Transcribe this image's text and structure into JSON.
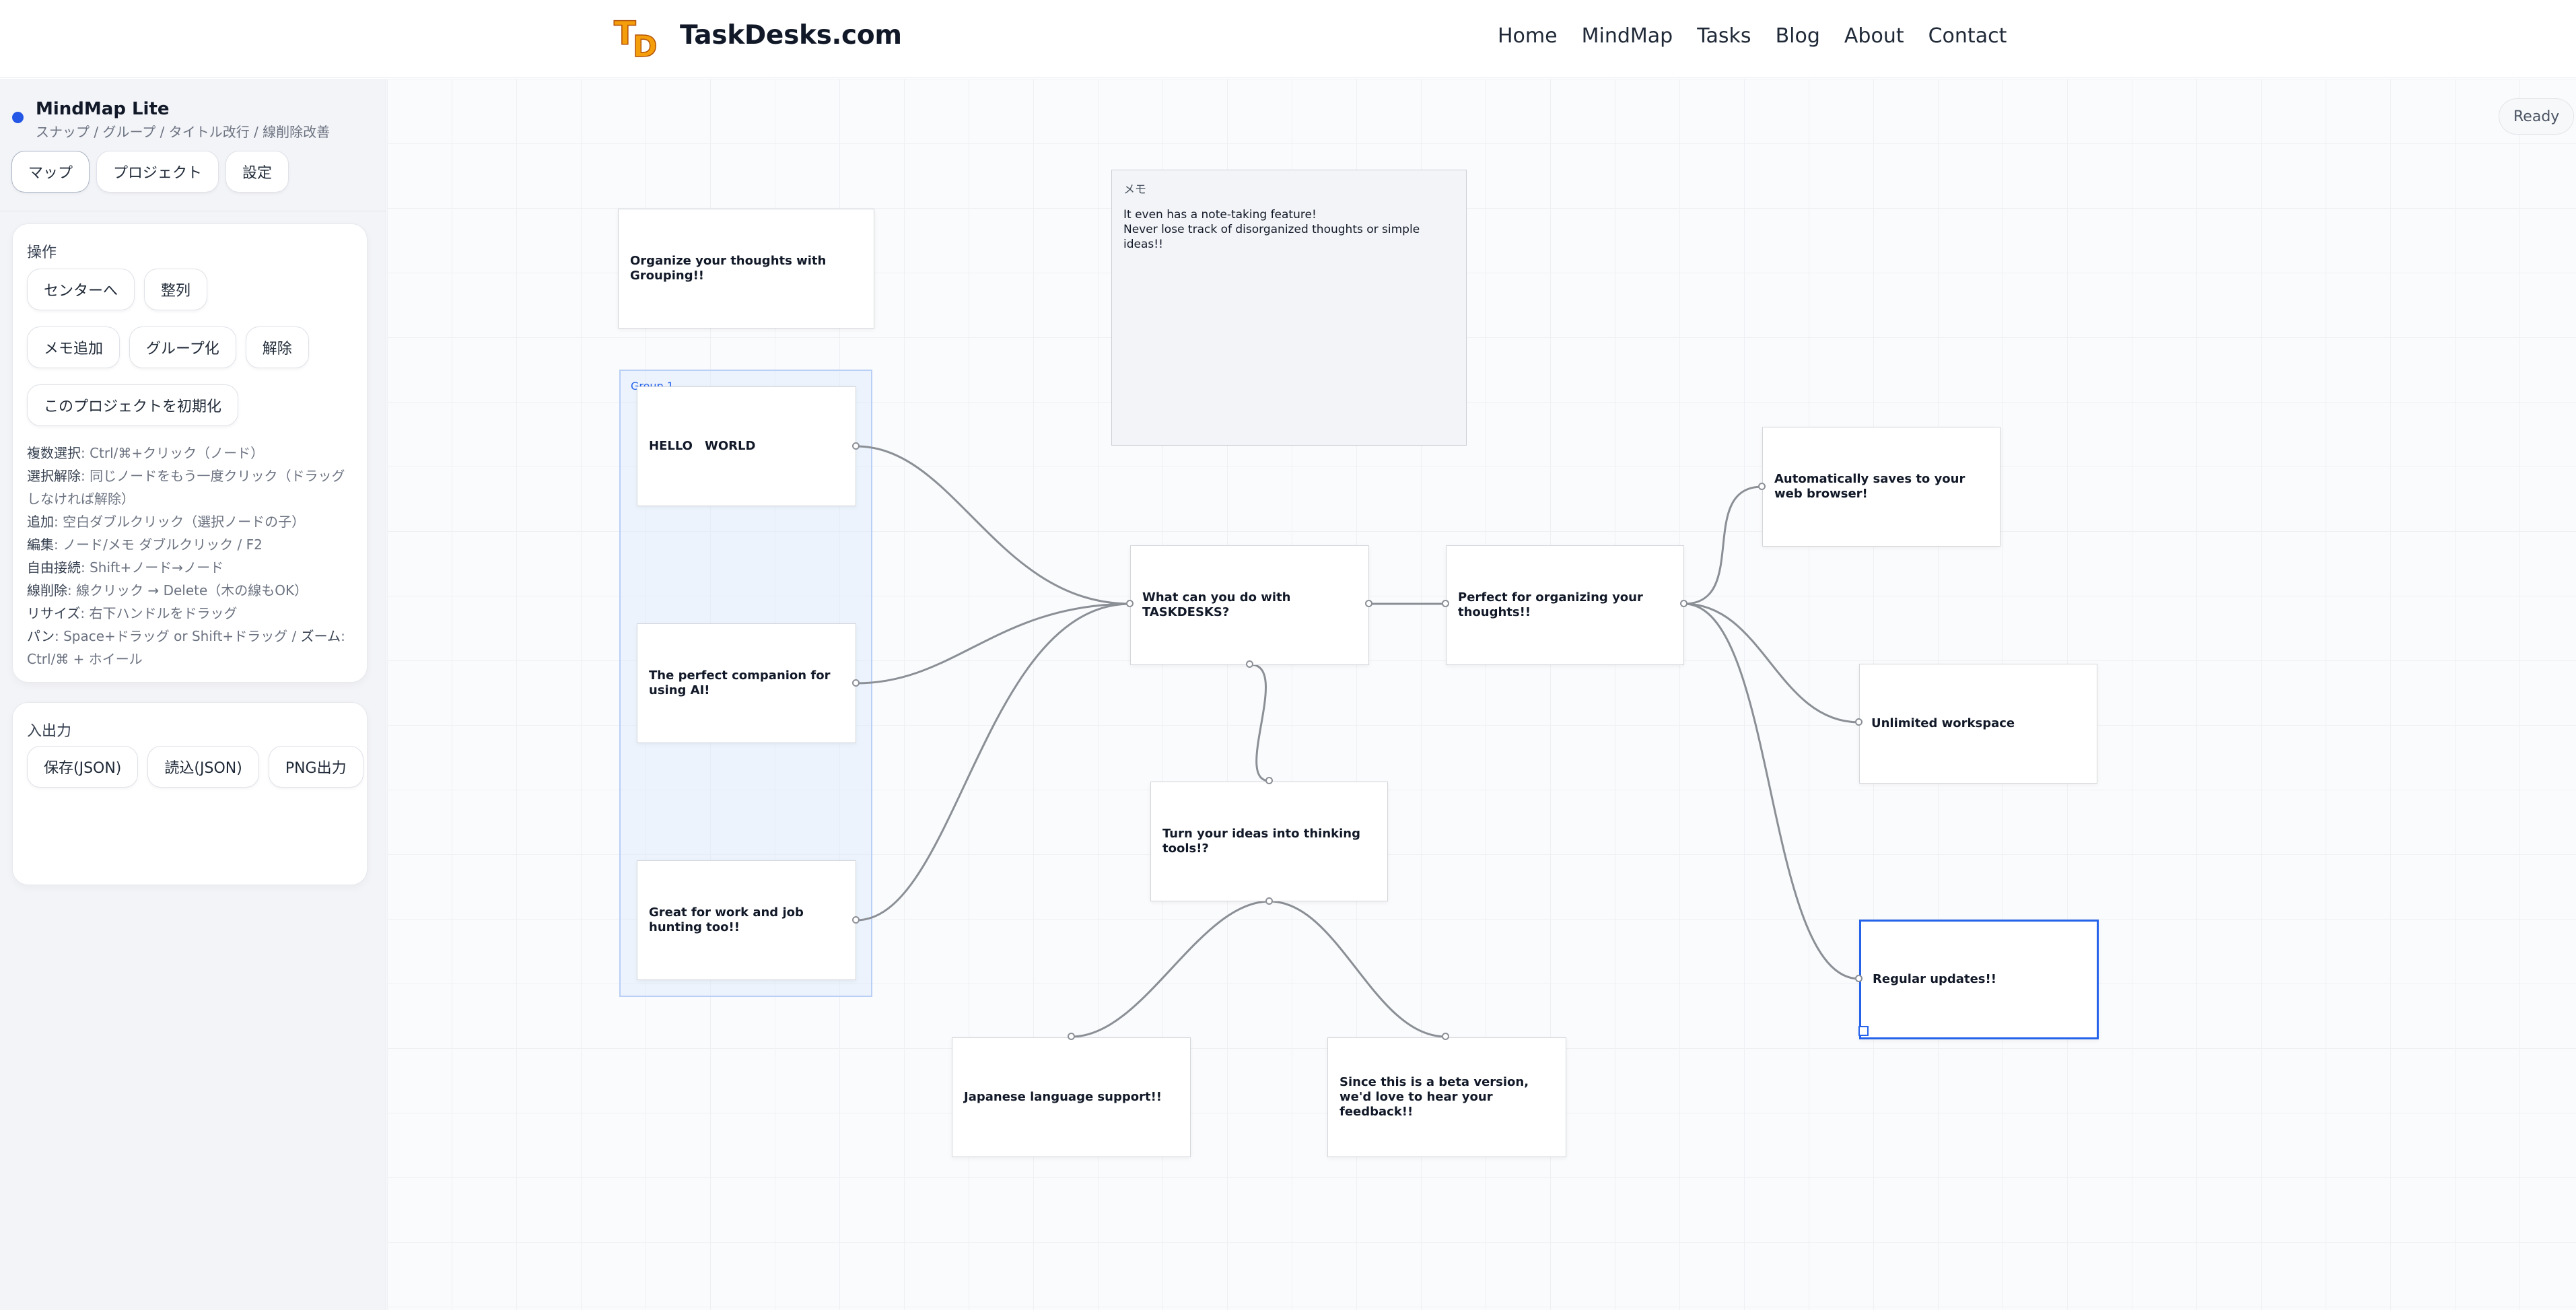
{
  "header": {
    "brand": "TaskDesks.com",
    "logo_text": "TD",
    "nav": [
      "Home",
      "MindMap",
      "Tasks",
      "Blog",
      "About",
      "Contact"
    ]
  },
  "sidebar": {
    "app_title": "MindMap Lite",
    "app_subtitle": "スナップ / グループ / タイトル改行 / 線削除改善",
    "tabs": [
      "マップ",
      "プロジェクト",
      "設定"
    ],
    "operations": {
      "title": "操作",
      "buttons": [
        "センターへ",
        "整列",
        "メモ追加",
        "グループ化",
        "解除",
        "このプロジェクトを初期化"
      ]
    },
    "help": [
      {
        "key": "複数選択",
        "text": ": Ctrl/⌘+クリック（ノード）"
      },
      {
        "key": "選択解除",
        "text": ": 同じノードをもう一度クリック（ドラッグしなければ解除）"
      },
      {
        "key": "追加",
        "text": ": 空白ダブルクリック（選択ノードの子）"
      },
      {
        "key": "編集",
        "text": ": ノード/メモ ダブルクリック / F2"
      },
      {
        "key": "自由接続",
        "text": ": Shift+ノード→ノード"
      },
      {
        "key": "線削除",
        "text": ": 線クリック → Delete（木の線もOK）"
      },
      {
        "key": "リサイズ",
        "text": ": 右下ハンドルをドラッグ"
      },
      {
        "key": "パン",
        "text": ": Space+ドラッグ or Shift+ドラッグ / "
      },
      {
        "key": "ズーム",
        "text": ": Ctrl/⌘ + ホイール"
      }
    ],
    "io": {
      "title": "入出力",
      "buttons": [
        "保存(JSON)",
        "読込(JSON)",
        "PNG出力"
      ]
    }
  },
  "canvas": {
    "status": "Ready",
    "group_label": "Group 1",
    "memo": {
      "title": "メモ",
      "lines": [
        "It even has a note-taking feature!",
        "Never lose track of disorganized thoughts or simple ideas!!"
      ]
    },
    "nodes": {
      "grouping": "Organize your thoughts with Grouping!!",
      "hello": "HELLO　WORLD",
      "companion": "The perfect companion for using AI!",
      "work": "Great for work and job hunting too!!",
      "center": "What can you do with TASKDESKS?",
      "thinking": "Turn your ideas into thinking tools!?",
      "japanese": "Japanese language support!!",
      "beta": "Since this is a beta version, we'd love to hear your feedback!!",
      "organizing": "Perfect for organizing your thoughts!!",
      "autosave": "Automatically saves to your web browser!",
      "workspace": "Unlimited workspace",
      "updates": "Regular updates!!"
    }
  },
  "colors": {
    "accent": "#2563eb",
    "logo_orange": "#f59e0b",
    "edge": "#8b8f96"
  }
}
